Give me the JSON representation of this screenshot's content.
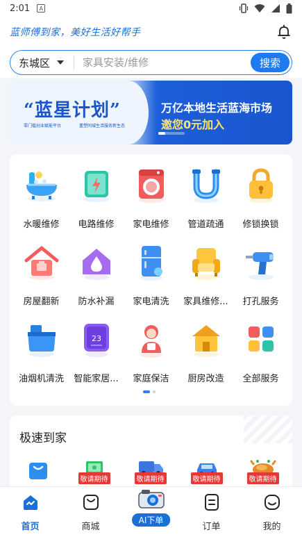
{
  "status_bar": {
    "time": "2:01",
    "notif": "A"
  },
  "header": {
    "slogan": "蓝师傅到家，美好生活好帮手"
  },
  "search": {
    "district": "东城区",
    "placeholder": "家具安装/维修",
    "button": "搜索"
  },
  "banner": {
    "title": "“蓝星计划”",
    "sub1": "零门槛创业赋能平台",
    "sub2": "重塑同城生活服务新生态",
    "line1": "万亿本地生活蓝海市场",
    "line2": "邀您0元加入",
    "progress": 0.25
  },
  "services": [
    {
      "label": "水暖维修",
      "icon": "bathtub-icon"
    },
    {
      "label": "电路维修",
      "icon": "electric-box-icon"
    },
    {
      "label": "家电维修",
      "icon": "washing-machine-icon"
    },
    {
      "label": "管道疏通",
      "icon": "pipe-icon"
    },
    {
      "label": "修锁换锁",
      "icon": "lock-icon"
    },
    {
      "label": "房屋翻新",
      "icon": "house-icon"
    },
    {
      "label": "防水补漏",
      "icon": "waterproof-icon"
    },
    {
      "label": "家电清洗",
      "icon": "fridge-icon"
    },
    {
      "label": "家具维修...",
      "icon": "sofa-icon"
    },
    {
      "label": "打孔服务",
      "icon": "drill-icon"
    },
    {
      "label": "油烟机清洗",
      "icon": "range-hood-icon"
    },
    {
      "label": "智能家居...",
      "icon": "thermostat-icon"
    },
    {
      "label": "家庭保洁",
      "icon": "cleaner-icon"
    },
    {
      "label": "厨房改造",
      "icon": "kitchen-house-icon"
    },
    {
      "label": "全部服务",
      "icon": "all-services-icon"
    }
  ],
  "speed": {
    "title": "极速到家",
    "badge": "敬请期待",
    "items": [
      {
        "icon": "shopping-bag-icon",
        "badge": false
      },
      {
        "icon": "money-icon",
        "badge": true
      },
      {
        "icon": "truck-icon",
        "badge": true
      },
      {
        "icon": "car-icon",
        "badge": true
      },
      {
        "icon": "roast-chicken-icon",
        "badge": true
      }
    ]
  },
  "tabs": [
    {
      "label": "首页",
      "icon": "home-icon",
      "active": true
    },
    {
      "label": "商城",
      "icon": "bag-icon",
      "active": false
    },
    {
      "label": "AI下单",
      "icon": "camera-icon",
      "active": false
    },
    {
      "label": "订单",
      "icon": "order-icon",
      "active": false
    },
    {
      "label": "我的",
      "icon": "profile-icon",
      "active": false
    }
  ],
  "colors": {
    "primary": "#1d7af0",
    "brand_text": "#1d6fd8",
    "badge_red": "#e53935"
  }
}
